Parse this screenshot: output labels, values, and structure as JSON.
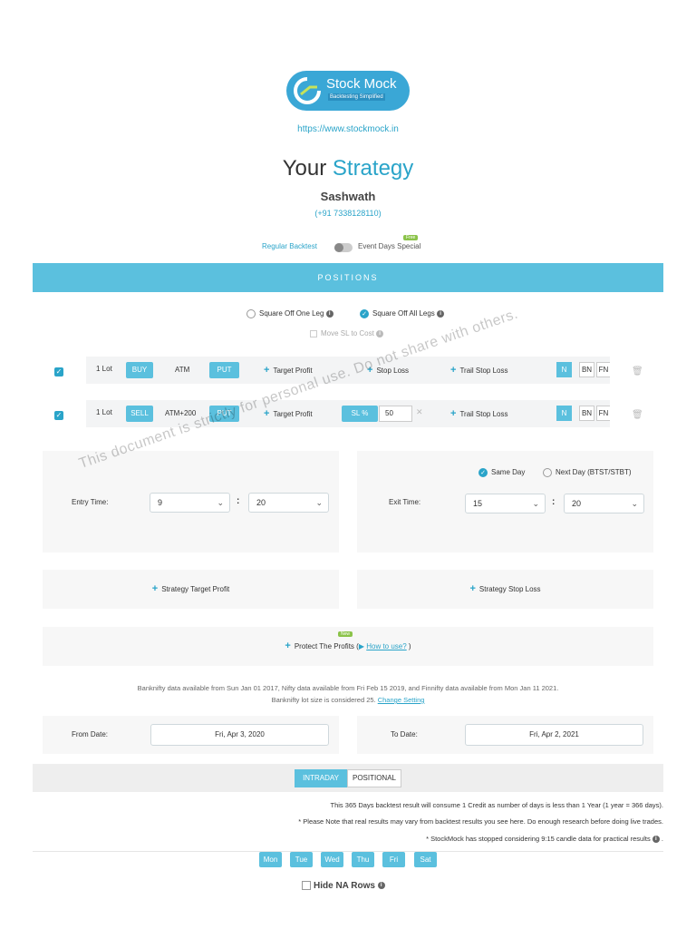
{
  "header": {
    "logo_title": "Stock Mock",
    "logo_tagline": "Backtesting Simplified",
    "url": "https://www.stockmock.in",
    "title_part1": "Your",
    "title_part2": "Strategy",
    "user_name": "Sashwath",
    "phone": "(+91 7338128110)"
  },
  "mode": {
    "regular": "Regular Backtest",
    "event": "Event Days Special",
    "free_badge": "Free"
  },
  "positions_header": "POSITIONS",
  "square_off": {
    "one_leg": "Square Off One Leg",
    "all_legs": "Square Off All Legs",
    "move_sl": "Move SL to Cost"
  },
  "legs": [
    {
      "lots": "1 Lot",
      "side": "BUY",
      "strike": "ATM",
      "type": "PUT",
      "target": "Target Profit",
      "stop": "Stop Loss",
      "trail": "Trail Stop Loss",
      "index": [
        "N",
        "BN",
        "FN"
      ]
    },
    {
      "lots": "1 Lot",
      "side": "SELL",
      "strike": "ATM+200",
      "type": "PUT",
      "target": "Target Profit",
      "sl_label": "SL %",
      "sl_value": "50",
      "trail": "Trail Stop Loss",
      "index": [
        "N",
        "BN",
        "FN"
      ]
    }
  ],
  "watermark": "This document is strictly for personal use. Do not share with others.",
  "timing": {
    "entry_label": "Entry Time:",
    "entry_hour": "9",
    "entry_min": "20",
    "same_day": "Same Day",
    "next_day": "Next Day (BTST/STBT)",
    "exit_label": "Exit Time:",
    "exit_hour": "15",
    "exit_min": "20",
    "colon": ":"
  },
  "strategy": {
    "target": "Strategy Target Profit",
    "stop": "Strategy Stop Loss",
    "protect": "Protect The Profits (",
    "how_to": "How to use?",
    "close_paren": ")",
    "new_badge": "New"
  },
  "info": {
    "availability": "Banknifty data available from Sun Jan 01 2017, Nifty data available from Fri Feb 15 2019, and Finnifty data available from Mon Jan 11 2021.",
    "lot_size": "Banknifty lot size is considered 25.",
    "change_setting": "Change Setting"
  },
  "dates": {
    "from_label": "From Date:",
    "from_value": "Fri, Apr 3, 2020",
    "to_label": "To Date:",
    "to_value": "Fri, Apr 2, 2021"
  },
  "tabs": {
    "intraday": "INTRADAY",
    "positional": "POSITIONAL"
  },
  "notes": {
    "credit": "This 365 Days backtest result will consume 1 Credit as number of days is less than 1 Year (1 year = 366 days).",
    "real_results": "* Please Note that real results may vary from backtest results you see here. Do enough research before doing live trades.",
    "candle": "* StockMock has stopped considering 9:15 candle data for practical results",
    "candle_tail": "."
  },
  "days": [
    "Mon",
    "Tue",
    "Wed",
    "Thu",
    "Fri",
    "Sat"
  ],
  "hide_na": "Hide NA Rows",
  "colors": {
    "accent": "#2aa4c9",
    "header_bar": "#5bc0de",
    "badge_green": "#8bc34a"
  }
}
